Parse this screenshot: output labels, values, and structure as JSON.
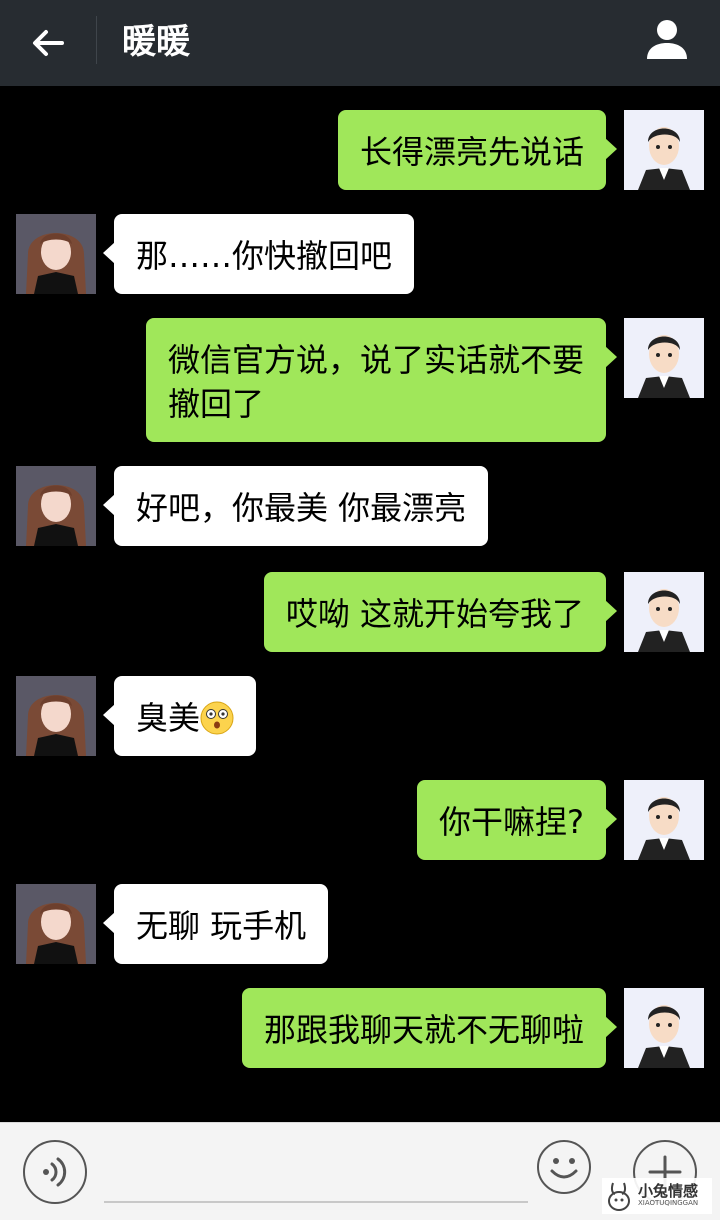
{
  "header": {
    "title": "暖暖",
    "back_icon": "arrow-left-icon",
    "profile_icon": "person-icon",
    "background": "#272c31"
  },
  "colors": {
    "outgoing_bubble": "#a0e75a",
    "incoming_bubble": "#ffffff",
    "chat_background": "#000000"
  },
  "messages": [
    {
      "sender": "me",
      "text": "长得漂亮先说话"
    },
    {
      "sender": "other",
      "text": "那……你快撤回吧"
    },
    {
      "sender": "me",
      "line1": "微信官方说，说了实话就不要",
      "line2": "撤回了"
    },
    {
      "sender": "other",
      "text": "好吧，你最美 你最漂亮"
    },
    {
      "sender": "me",
      "text": "哎呦 这就开始夸我了"
    },
    {
      "sender": "other",
      "text": "臭美",
      "emoji": "surprised-face-emoji"
    },
    {
      "sender": "me",
      "text": "你干嘛捏?"
    },
    {
      "sender": "other",
      "text": "无聊 玩手机"
    },
    {
      "sender": "me",
      "text": "那跟我聊天就不无聊啦"
    }
  ],
  "input_bar": {
    "voice_icon": "voice-icon",
    "input_value": "",
    "emoji_icon": "smiley-icon",
    "more_icon": "plus-icon"
  },
  "watermark": {
    "text": "小兔情感",
    "subtext": "XIAOTUQINGGAN"
  }
}
